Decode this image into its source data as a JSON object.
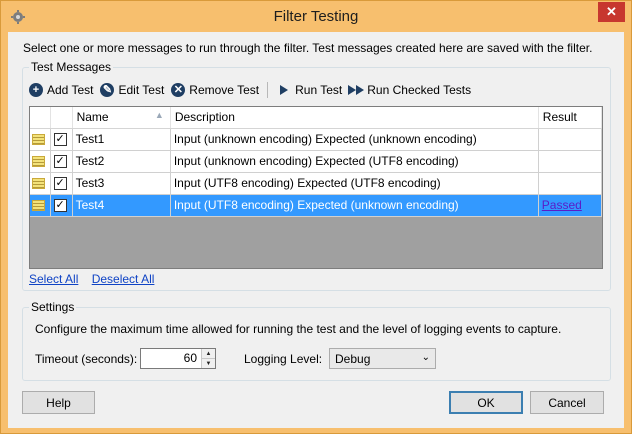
{
  "window": {
    "title": "Filter Testing",
    "close_label": "✕",
    "accent_color": "#f7bf6e"
  },
  "intro": "Select one or more messages to run through the filter. Test messages created here are saved with the filter.",
  "test_messages": {
    "group_label": "Test Messages",
    "toolbar": {
      "add": "Add Test",
      "edit": "Edit Test",
      "remove": "Remove Test",
      "run": "Run Test",
      "run_checked": "Run Checked Tests"
    },
    "columns": [
      "Name",
      "Description",
      "Result"
    ],
    "sort_indicator": "▲",
    "rows": [
      {
        "checked": true,
        "name": "Test1",
        "description": "Input (unknown encoding) Expected (unknown encoding)",
        "result": "",
        "selected": false
      },
      {
        "checked": true,
        "name": "Test2",
        "description": "Input (unknown encoding) Expected (UTF8 encoding)",
        "result": "",
        "selected": false
      },
      {
        "checked": true,
        "name": "Test3",
        "description": "Input (UTF8 encoding) Expected (UTF8 encoding)",
        "result": "",
        "selected": false
      },
      {
        "checked": true,
        "name": "Test4",
        "description": "Input (UTF8 encoding) Expected (unknown encoding)",
        "result": "Passed",
        "selected": true
      }
    ],
    "select_all": "Select All",
    "deselect_all": "Deselect All"
  },
  "settings": {
    "group_label": "Settings",
    "description": "Configure the maximum time allowed for running the test and the level of logging events to capture.",
    "timeout_label": "Timeout (seconds):",
    "timeout_value": "60",
    "logging_label": "Logging Level:",
    "logging_value": "Debug"
  },
  "buttons": {
    "help": "Help",
    "ok": "OK",
    "cancel": "Cancel"
  }
}
